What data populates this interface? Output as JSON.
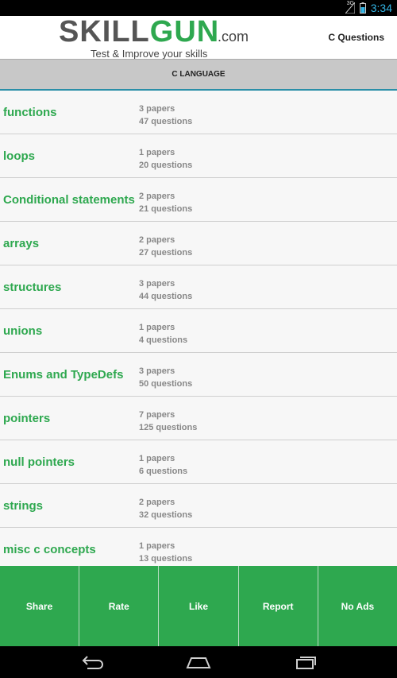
{
  "status_bar": {
    "network": "3G",
    "time": "3:34"
  },
  "header": {
    "logo_skill": "SKILL",
    "logo_gun": "GUN",
    "logo_com": ".com",
    "tagline": "Test & Improve your skills",
    "right_label": "C Questions"
  },
  "category": {
    "title": "C LANGUAGE"
  },
  "topics": [
    {
      "name": "functions",
      "papers": "3 papers",
      "questions": "47 questions"
    },
    {
      "name": "loops",
      "papers": "1 papers",
      "questions": "20 questions"
    },
    {
      "name": "Conditional statements",
      "papers": "2 papers",
      "questions": "21 questions"
    },
    {
      "name": "arrays",
      "papers": "2 papers",
      "questions": "27 questions"
    },
    {
      "name": "structures",
      "papers": "3 papers",
      "questions": "44 questions"
    },
    {
      "name": "unions",
      "papers": "1 papers",
      "questions": "4 questions"
    },
    {
      "name": "Enums and TypeDefs",
      "papers": "3 papers",
      "questions": "50 questions"
    },
    {
      "name": "pointers",
      "papers": "7 papers",
      "questions": "125 questions"
    },
    {
      "name": "null pointers",
      "papers": "1 papers",
      "questions": "6 questions"
    },
    {
      "name": "strings",
      "papers": "2 papers",
      "questions": "32 questions"
    },
    {
      "name": "misc c concepts",
      "papers": "1 papers",
      "questions": "13 questions"
    }
  ],
  "actions": {
    "share": "Share",
    "rate": "Rate",
    "like": "Like",
    "report": "Report",
    "no_ads": "No Ads"
  },
  "colors": {
    "accent_green": "#2ea84f",
    "status_blue": "#33b5e5",
    "category_bar": "#c8c8c8"
  }
}
